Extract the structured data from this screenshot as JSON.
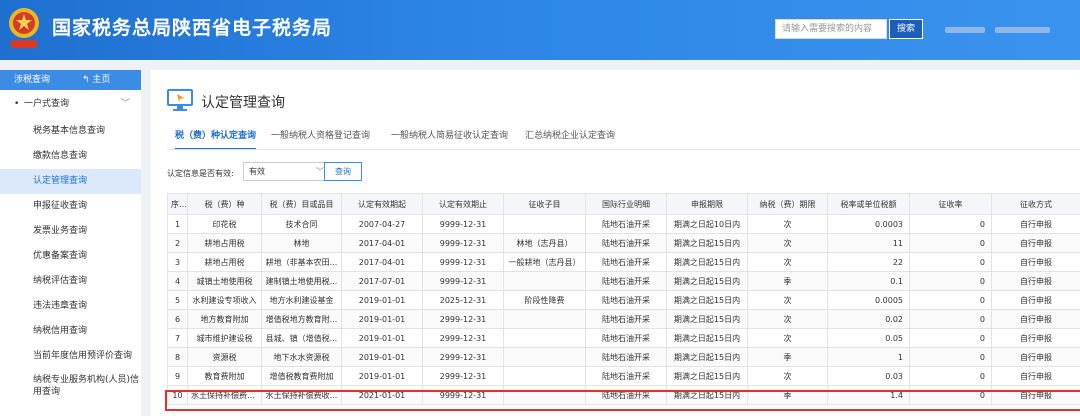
{
  "header": {
    "site_title": "国家税务总局陕西省电子税务局",
    "search_placeholder": "请输入需要搜索的内容",
    "search_button": "搜索"
  },
  "sidebar": {
    "top_left": "涉税查询",
    "top_right": "主页",
    "group_label": "一户式查询",
    "items": [
      {
        "label": "税务基本信息查询"
      },
      {
        "label": "缴款信息查询"
      },
      {
        "label": "认定管理查询"
      },
      {
        "label": "申报征收查询"
      },
      {
        "label": "发票业务查询"
      },
      {
        "label": "优惠备案查询"
      },
      {
        "label": "纳税评估查询"
      },
      {
        "label": "违法违章查询"
      },
      {
        "label": "纳税信用查询"
      },
      {
        "label": "当前年度信用预评价查询"
      },
      {
        "label": "纳税专业服务机构(人员)信用查询"
      }
    ]
  },
  "main": {
    "page_title": "认定管理查询",
    "tabs": [
      {
        "label": "税（费）种认定查询"
      },
      {
        "label": "一般纳税人资格登记查询"
      },
      {
        "label": "一般纳税人简易征收认定查询"
      },
      {
        "label": "汇总纳税企业认定查询"
      }
    ],
    "filter": {
      "label": "认定信息是否有效:",
      "value": "有效",
      "query_button": "查询"
    },
    "table": {
      "headers": [
        "序号",
        "税（费）种",
        "税（费）目或品目",
        "认定有效期起",
        "认定有效期止",
        "征收子目",
        "国际行业明细",
        "申报期限",
        "纳税（费）期限",
        "税率或单位税额",
        "征收率",
        "征收方式"
      ],
      "rows": [
        [
          "1",
          "印花税",
          "技术合同",
          "2007-04-27",
          "9999-12-31",
          "",
          "陆地石油开采",
          "期满之日起10日内",
          "次",
          "0.0003",
          "0",
          "自行申报"
        ],
        [
          "2",
          "耕地占用税",
          "林地",
          "2017-04-01",
          "9999-12-31",
          "林地（志丹县）",
          "陆地石油开采",
          "期满之日起15日内",
          "次",
          "11",
          "0",
          "自行申报"
        ],
        [
          "3",
          "耕地占用税",
          "耕地（非基本农田...",
          "2017-04-01",
          "9999-12-31",
          "一般耕地（志丹县）",
          "陆地石油开采",
          "期满之日起15日内",
          "次",
          "22",
          "0",
          "自行申报"
        ],
        [
          "4",
          "城镇土地使用税",
          "建制镇土地使用税...",
          "2017-07-01",
          "9999-12-31",
          "",
          "陆地石油开采",
          "期满之日起15日内",
          "季",
          "0.1",
          "0",
          "自行申报"
        ],
        [
          "5",
          "水利建设专项收入",
          "地方水利建设基金",
          "2019-01-01",
          "2025-12-31",
          "阶段性降费",
          "陆地石油开采",
          "期满之日起15日内",
          "次",
          "0.0005",
          "0",
          "自行申报"
        ],
        [
          "6",
          "地方教育附加",
          "增值税地方教育附...",
          "2019-01-01",
          "2999-12-31",
          "",
          "陆地石油开采",
          "期满之日起15日内",
          "次",
          "0.02",
          "0",
          "自行申报"
        ],
        [
          "7",
          "城市维护建设税",
          "县城、镇（增值税...",
          "2019-01-01",
          "2999-12-31",
          "",
          "陆地石油开采",
          "期满之日起15日内",
          "次",
          "0.05",
          "0",
          "自行申报"
        ],
        [
          "8",
          "资源税",
          "地下水水资源税",
          "2019-01-01",
          "2999-12-31",
          "",
          "陆地石油开采",
          "期满之日起15日内",
          "季",
          "1",
          "0",
          "自行申报"
        ],
        [
          "9",
          "教育费附加",
          "增值税教育费附加",
          "2019-01-01",
          "2999-12-31",
          "",
          "陆地石油开采",
          "期满之日起15日内",
          "次",
          "0.03",
          "0",
          "自行申报"
        ],
        [
          "10",
          "水土保持补偿费收...",
          "水土保持补偿费收...",
          "2021-01-01",
          "9999-12-31",
          "",
          "陆地石油开采",
          "期满之日起15日内",
          "季",
          "1.4",
          "0",
          "自行申报"
        ]
      ]
    }
  },
  "colors": {
    "header_blue": "#2d86e6",
    "accent": "#1d6fd2",
    "highlight_red": "#e03131"
  }
}
